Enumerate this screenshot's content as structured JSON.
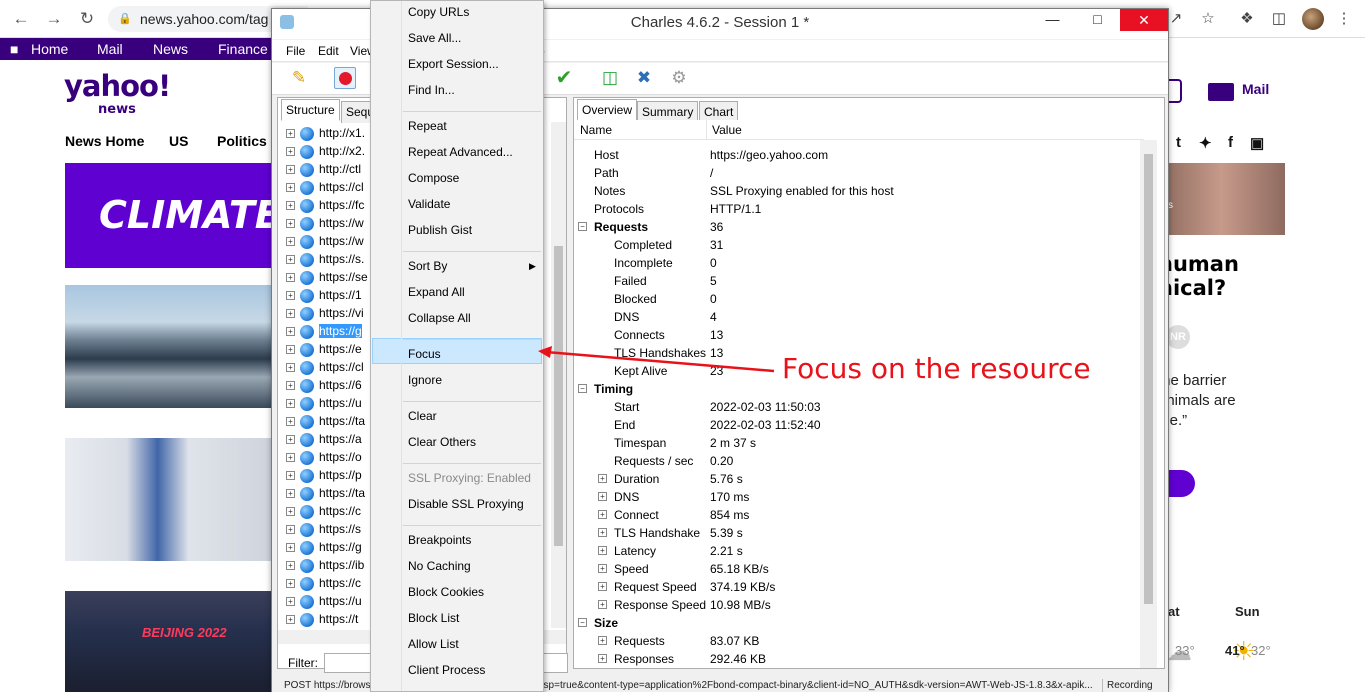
{
  "browser": {
    "url": "news.yahoo.com/tag",
    "icons": [
      "back-icon",
      "forward-icon",
      "reload-icon",
      "lock-icon",
      "share-icon",
      "star-icon",
      "extensions-icon",
      "sidebar-icon",
      "profile-avatar",
      "more-icon"
    ]
  },
  "yahoo": {
    "topbar": [
      "Home",
      "Mail",
      "News",
      "Finance"
    ],
    "logo": "yahoo!",
    "logo_sub": "news",
    "nav": [
      "News Home",
      "US",
      "Politics"
    ],
    "hero_text": "CLIMATE C",
    "image3_text": "BEIJING 2022",
    "mail_label": "Mail",
    "side_tag": "s",
    "headline_lines": [
      "human",
      "hical?"
    ],
    "avatar_initials": "NR",
    "quote_lines": [
      "the barrier",
      "animals are",
      "ble.”"
    ],
    "weather": {
      "days": [
        "at",
        "Sun"
      ],
      "temps": [
        "33°",
        "41°",
        "32°"
      ]
    }
  },
  "charles": {
    "title": "Charles 4.6.2 - Session 1 *",
    "menu": [
      "File",
      "Edit",
      "View",
      "p"
    ],
    "left_tabs": [
      "Structure",
      "Sequ"
    ],
    "tree_rows": [
      "http://x1.",
      "http://x2.",
      "http://ctl",
      "https://cl",
      "https://fc",
      "https://w",
      "https://w",
      "https://s.",
      "https://se",
      "https://1",
      "https://vi",
      "https://g",
      "https://e",
      "https://cl",
      "https://6",
      "https://u",
      "https://ta",
      "https://a",
      "https://o",
      "https://p",
      "https://ta",
      "https://c",
      "https://s",
      "https://g",
      "https://ib",
      "https://c",
      "https://u",
      "https://t"
    ],
    "selected_row": 11,
    "filter_label": "Filter:",
    "right_tabs": [
      "Overview",
      "Summary",
      "Chart"
    ],
    "columns": [
      "Name",
      "Value"
    ],
    "overview": [
      {
        "indent": 0,
        "expand": "",
        "bold": false,
        "name": "Host",
        "value": "https://geo.yahoo.com"
      },
      {
        "indent": 0,
        "expand": "",
        "bold": false,
        "name": "Path",
        "value": "/"
      },
      {
        "indent": 0,
        "expand": "",
        "bold": false,
        "name": "Notes",
        "value": "SSL Proxying enabled for this host"
      },
      {
        "indent": 0,
        "expand": "",
        "bold": false,
        "name": "Protocols",
        "value": "HTTP/1.1"
      },
      {
        "indent": 0,
        "expand": "−",
        "bold": true,
        "name": "Requests",
        "value": "36"
      },
      {
        "indent": 1,
        "expand": "",
        "bold": false,
        "name": "Completed",
        "value": "31"
      },
      {
        "indent": 1,
        "expand": "",
        "bold": false,
        "name": "Incomplete",
        "value": "0"
      },
      {
        "indent": 1,
        "expand": "",
        "bold": false,
        "name": "Failed",
        "value": "5"
      },
      {
        "indent": 1,
        "expand": "",
        "bold": false,
        "name": "Blocked",
        "value": "0"
      },
      {
        "indent": 1,
        "expand": "",
        "bold": false,
        "name": "DNS",
        "value": "4"
      },
      {
        "indent": 1,
        "expand": "",
        "bold": false,
        "name": "Connects",
        "value": "13"
      },
      {
        "indent": 1,
        "expand": "",
        "bold": false,
        "name": "TLS Handshakes",
        "value": "13"
      },
      {
        "indent": 1,
        "expand": "",
        "bold": false,
        "name": "Kept Alive",
        "value": "23"
      },
      {
        "indent": 0,
        "expand": "−",
        "bold": true,
        "name": "Timing",
        "value": ""
      },
      {
        "indent": 1,
        "expand": "",
        "bold": false,
        "name": "Start",
        "value": "2022-02-03 11:50:03"
      },
      {
        "indent": 1,
        "expand": "",
        "bold": false,
        "name": "End",
        "value": "2022-02-03 11:52:40"
      },
      {
        "indent": 1,
        "expand": "",
        "bold": false,
        "name": "Timespan",
        "value": "2 m 37 s"
      },
      {
        "indent": 1,
        "expand": "",
        "bold": false,
        "name": "Requests / sec",
        "value": "0.20"
      },
      {
        "indent": 1,
        "expand": "+",
        "bold": false,
        "name": "Duration",
        "value": "5.76 s"
      },
      {
        "indent": 1,
        "expand": "+",
        "bold": false,
        "name": "DNS",
        "value": "170 ms"
      },
      {
        "indent": 1,
        "expand": "+",
        "bold": false,
        "name": "Connect",
        "value": "854 ms"
      },
      {
        "indent": 1,
        "expand": "+",
        "bold": false,
        "name": "TLS Handshake",
        "value": "5.39 s"
      },
      {
        "indent": 1,
        "expand": "+",
        "bold": false,
        "name": "Latency",
        "value": "2.21 s"
      },
      {
        "indent": 1,
        "expand": "+",
        "bold": false,
        "name": "Speed",
        "value": "65.18 KB/s"
      },
      {
        "indent": 1,
        "expand": "+",
        "bold": false,
        "name": "Request Speed",
        "value": "374.19 KB/s"
      },
      {
        "indent": 1,
        "expand": "+",
        "bold": false,
        "name": "Response Speed",
        "value": "10.98 MB/s"
      },
      {
        "indent": 0,
        "expand": "−",
        "bold": true,
        "name": "Size",
        "value": ""
      },
      {
        "indent": 1,
        "expand": "+",
        "bold": false,
        "name": "Requests",
        "value": "83.07 KB"
      },
      {
        "indent": 1,
        "expand": "+",
        "bold": false,
        "name": "Responses",
        "value": "292.46 KB"
      }
    ],
    "status": "POST https://brows",
    "status_right": "qsp=true&content-type=application%2Fbond-compact-binary&client-id=NO_AUTH&sdk-version=AWT-Web-JS-1.8.3&x-apik...",
    "recording": "Recording"
  },
  "context_menu": {
    "groups": [
      [
        "Copy URLs",
        "Save All...",
        "Export Session...",
        "Find In..."
      ],
      [
        "Repeat",
        "Repeat Advanced...",
        "Compose",
        "Validate",
        "Publish Gist"
      ],
      [
        "Sort By",
        "Expand All",
        "Collapse All"
      ],
      [
        "Focus",
        "Ignore"
      ],
      [
        "Clear",
        "Clear Others"
      ],
      [
        "SSL Proxying: Enabled",
        "Disable SSL Proxying"
      ],
      [
        "Breakpoints",
        "No Caching",
        "Block Cookies",
        "Block List",
        "Allow List",
        "Client Process"
      ]
    ],
    "highlighted": "Focus",
    "disabled": [
      "SSL Proxying: Enabled"
    ],
    "submenu": [
      "Sort By"
    ]
  },
  "annotation": {
    "text": "Focus on the resource",
    "color": "#e8131a"
  }
}
